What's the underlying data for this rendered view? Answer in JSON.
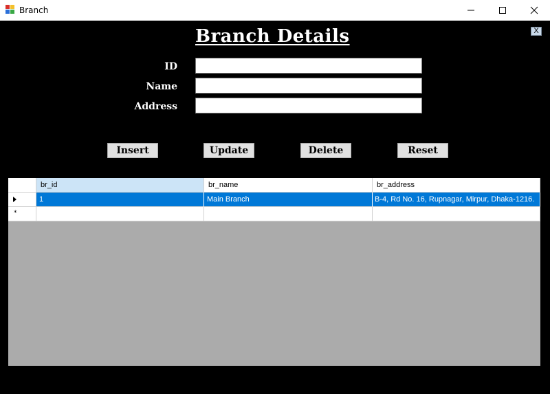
{
  "window": {
    "title": "Branch",
    "controls": {
      "minimize_icon": "minimize-icon",
      "maximize_icon": "maximize-icon",
      "close_icon": "close-icon"
    }
  },
  "form": {
    "close_label": "X",
    "heading": "Branch Details",
    "fields": [
      {
        "label": "ID",
        "value": ""
      },
      {
        "label": "Name",
        "value": ""
      },
      {
        "label": "Address",
        "value": ""
      }
    ],
    "buttons": {
      "insert": "Insert",
      "update": "Update",
      "delete": "Delete",
      "reset": "Reset"
    }
  },
  "grid": {
    "columns": [
      "br_id",
      "br_name",
      "br_address"
    ],
    "rows": [
      {
        "br_id": "1",
        "br_name": "Main Branch",
        "br_address": "B-4, Rd No. 16, Rupnagar, Mirpur, Dhaka-1216."
      }
    ],
    "new_row_marker": "*",
    "colors": {
      "selection": "#0078d7",
      "header_selected": "#cce4f7",
      "background": "#ababab"
    }
  }
}
